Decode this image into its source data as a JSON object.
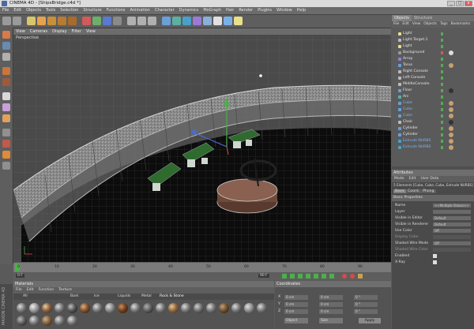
{
  "window": {
    "title": "CINEMA 4D - [ShipsBridge.c4d *]",
    "buttons": [
      "_",
      "□",
      "x"
    ]
  },
  "menu": [
    "File",
    "Edit",
    "Objects",
    "Tools",
    "Selection",
    "Structure",
    "Functions",
    "Animation",
    "Character",
    "Dynamics",
    "MoGraph",
    "Hair",
    "Render",
    "Plugins",
    "Window",
    "Help"
  ],
  "viewport": {
    "menu": [
      "View",
      "Cameras",
      "Display",
      "Filter",
      "View"
    ],
    "label": "Perspective"
  },
  "objects_panel": {
    "tabs": [
      "Objects",
      "Structure"
    ],
    "menu": [
      "File",
      "Edit",
      "View",
      "Objects",
      "Tags",
      "Bookmarks"
    ],
    "items": [
      "Light",
      "Light.Target.1",
      "Light",
      "Background",
      "Array",
      "Torus",
      "Right Console",
      "Left Console",
      "MiddleConsole",
      "Floor",
      "Arc",
      "Cube",
      "Cube",
      "Cube",
      "Chair",
      "Cylinder",
      "Cylinder",
      "Extrude NURBS",
      "Extrude NURBS"
    ]
  },
  "attributes_panel": {
    "header": "Attributes",
    "menu": [
      "Mode",
      "Edit",
      "User Data"
    ],
    "info": "5 Elements [Cube, Cube, Cube, Extrude NURBS]",
    "tabs": [
      "Basic",
      "Coord.",
      "Phong"
    ],
    "section": "Basic Properties",
    "rows": [
      {
        "label": "Name",
        "value": "<<Multiple Values>>"
      },
      {
        "label": "Layer",
        "value": ""
      },
      {
        "label": "Visible in Editor",
        "value": "Default"
      },
      {
        "label": "Visible in Renderer",
        "value": "Default"
      },
      {
        "label": "Use Color",
        "value": "Off"
      },
      {
        "label": "Display Color",
        "value": ""
      },
      {
        "label": "Shaded Wire Mode",
        "value": "Off"
      },
      {
        "label": "Shaded Wire Color",
        "value": ""
      },
      {
        "label": "Enabled",
        "value": ""
      },
      {
        "label": "X-Ray",
        "value": ""
      }
    ]
  },
  "timeline": {
    "marks": [
      "0",
      "10",
      "20",
      "30",
      "40",
      "50",
      "60",
      "70",
      "80",
      "90"
    ],
    "current": "0 F",
    "end": "90 F"
  },
  "materials_panel": {
    "header": "Materials",
    "menu": [
      "File",
      "Edit",
      "Function",
      "Texture"
    ],
    "filters": [
      "All",
      "Bark",
      "Ice",
      "Liquids",
      "Metal",
      "Rock & Stone"
    ]
  },
  "coordinates_panel": {
    "header": "Coordinates",
    "rows": [
      {
        "axis": "X",
        "a": "0 cm",
        "b": "0 cm",
        "c": "0 °"
      },
      {
        "axis": "Y",
        "a": "0 cm",
        "b": "0 cm",
        "c": "0 °"
      },
      {
        "axis": "Z",
        "a": "0 cm",
        "b": "0 cm",
        "c": "0 °"
      }
    ],
    "mode": "Object",
    "size_mode": "Size",
    "apply": "Apply"
  },
  "vertical_label": "MAXON CINEMA 4D",
  "colors": {
    "accent": "#7fb2e8",
    "selected": "#6b8ec2"
  }
}
